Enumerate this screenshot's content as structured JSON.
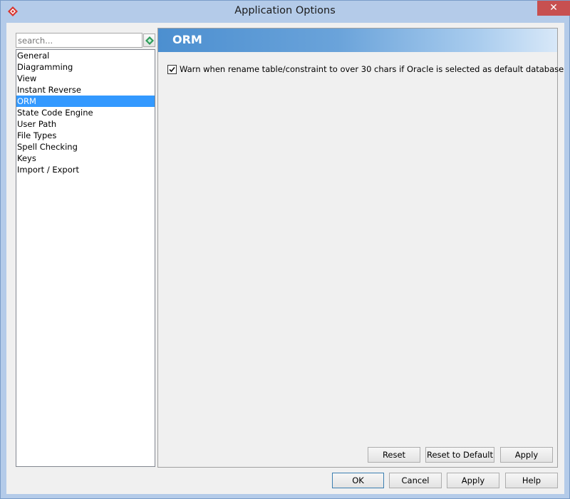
{
  "window": {
    "title": "Application Options",
    "close_glyph": "✕",
    "app_icon": "visual-paradigm-diamond-icon"
  },
  "search": {
    "placeholder": "search...",
    "button_icon": "green-diamond-icon"
  },
  "categories": [
    {
      "label": "General",
      "selected": false
    },
    {
      "label": "Diagramming",
      "selected": false
    },
    {
      "label": "View",
      "selected": false
    },
    {
      "label": "Instant Reverse",
      "selected": false
    },
    {
      "label": "ORM",
      "selected": true
    },
    {
      "label": "State Code Engine",
      "selected": false
    },
    {
      "label": "User Path",
      "selected": false
    },
    {
      "label": "File Types",
      "selected": false
    },
    {
      "label": "Spell Checking",
      "selected": false
    },
    {
      "label": "Keys",
      "selected": false
    },
    {
      "label": "Import / Export",
      "selected": false
    }
  ],
  "panel": {
    "title": "ORM",
    "options": [
      {
        "label": "Warn when rename table/constraint to over 30 chars if Oracle is selected as default database",
        "checked": true
      }
    ],
    "reset_label": "Reset",
    "reset_default_label": "Reset to Default",
    "apply_label": "Apply"
  },
  "footer": {
    "ok_label": "OK",
    "cancel_label": "Cancel",
    "apply_label": "Apply",
    "help_label": "Help"
  },
  "colors": {
    "selection": "#3399ff",
    "header_gradient_start": "#4c8fd0",
    "close_button": "#c75050"
  }
}
